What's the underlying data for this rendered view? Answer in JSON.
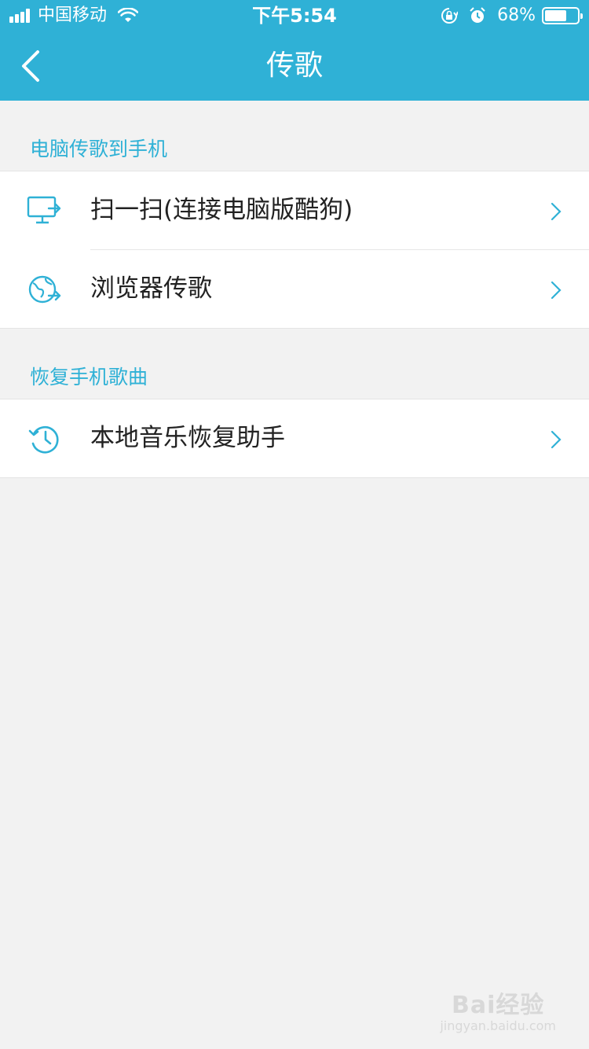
{
  "status_bar": {
    "carrier": "中国移动",
    "time": "下午5:54",
    "battery_percent": "68%",
    "battery_level": 0.68,
    "icons": [
      "signal-icon",
      "wifi-icon",
      "rotation-lock-icon",
      "alarm-icon",
      "battery-icon"
    ]
  },
  "nav": {
    "title": "传歌",
    "back_icon": "chevron-left-icon"
  },
  "sections": [
    {
      "header": "电脑传歌到手机",
      "items": [
        {
          "label": "扫一扫(连接电脑版酷狗)",
          "icon": "computer-transfer-icon"
        },
        {
          "label": "浏览器传歌",
          "icon": "browser-transfer-icon"
        }
      ]
    },
    {
      "header": "恢复手机歌曲",
      "items": [
        {
          "label": "本地音乐恢复助手",
          "icon": "history-icon"
        }
      ]
    }
  ],
  "watermark": {
    "main": "Bai经验",
    "sub": "jingyan.baidu.com"
  },
  "colors": {
    "accent": "#2fb1d6",
    "background": "#f2f2f2",
    "text": "#222222"
  }
}
